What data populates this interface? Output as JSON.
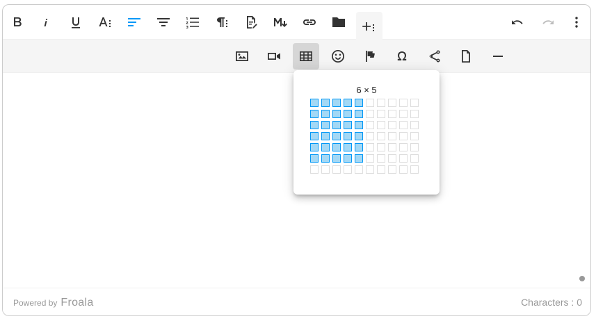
{
  "toolbar": {
    "main_buttons": [
      {
        "name": "bold-button",
        "icon": "bold-icon",
        "state": "normal"
      },
      {
        "name": "italic-button",
        "icon": "italic-icon",
        "state": "normal"
      },
      {
        "name": "underline-button",
        "icon": "underline-icon",
        "state": "normal"
      },
      {
        "name": "more-text-button",
        "icon": "font-more-icon",
        "state": "normal"
      },
      {
        "name": "align-left-button",
        "icon": "align-left-icon",
        "state": "active"
      },
      {
        "name": "align-center-button",
        "icon": "align-center-icon",
        "state": "normal"
      },
      {
        "name": "ordered-list-button",
        "icon": "ordered-list-icon",
        "state": "normal"
      },
      {
        "name": "more-paragraph-button",
        "icon": "paragraph-more-icon",
        "state": "normal"
      },
      {
        "name": "insert-file-button",
        "icon": "file-edit-icon",
        "state": "normal"
      },
      {
        "name": "markdown-button",
        "icon": "markdown-icon",
        "state": "normal"
      },
      {
        "name": "insert-link-button",
        "icon": "link-icon",
        "state": "normal"
      },
      {
        "name": "file-manager-button",
        "icon": "folder-icon",
        "state": "normal"
      },
      {
        "name": "more-rich-button",
        "icon": "plus-more-icon",
        "state": "open"
      }
    ],
    "right_buttons": [
      {
        "name": "undo-button",
        "icon": "undo-icon",
        "state": "normal"
      },
      {
        "name": "redo-button",
        "icon": "redo-icon",
        "state": "disabled"
      },
      {
        "name": "more-misc-button",
        "icon": "vertical-dots-icon",
        "state": "normal"
      }
    ],
    "rich_buttons": [
      {
        "name": "insert-image-button",
        "icon": "image-icon",
        "state": "normal"
      },
      {
        "name": "insert-video-button",
        "icon": "video-icon",
        "state": "normal"
      },
      {
        "name": "insert-table-button",
        "icon": "table-icon",
        "state": "selected"
      },
      {
        "name": "emoticons-button",
        "icon": "smiley-icon",
        "state": "normal"
      },
      {
        "name": "font-awesome-button",
        "icon": "flag-icon",
        "state": "normal"
      },
      {
        "name": "special-characters-button",
        "icon": "omega-icon",
        "state": "normal"
      },
      {
        "name": "embedly-button",
        "icon": "share-icon",
        "state": "normal"
      },
      {
        "name": "insert-file-doc-button",
        "icon": "document-icon",
        "state": "normal"
      },
      {
        "name": "insert-hr-button",
        "icon": "horizontal-line-icon",
        "state": "normal"
      }
    ]
  },
  "table_popup": {
    "size_label": "6 × 5",
    "grid_rows": 7,
    "grid_cols": 10,
    "selected_rows": 6,
    "selected_cols": 5
  },
  "footer": {
    "powered_by": "Powered by",
    "brand": "Froala",
    "characters": "Characters : 0"
  },
  "colors": {
    "accent": "#0098f7",
    "cell_highlight": "#a3d8f5",
    "toolbar_bg": "#f5f5f5",
    "selected_bg": "#d6d6d6"
  }
}
